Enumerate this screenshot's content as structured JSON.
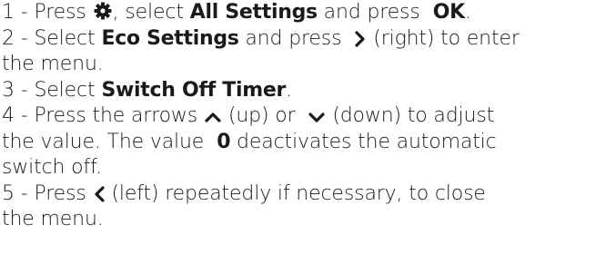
{
  "steps": {
    "s1": {
      "num": "1 -",
      "t1": "Press",
      "icon": "gear-icon",
      "t2": ", select",
      "b1": "All Settings",
      "t3": "and press",
      "b2": "OK",
      "t4": "."
    },
    "s2": {
      "num": "2 -",
      "t1": "Select",
      "b1": "Eco Settings",
      "t2": "and press",
      "icon": "chevron-right-icon",
      "t3": "(right) to enter",
      "t4": "the menu."
    },
    "s3": {
      "num": "3 -",
      "t1": "Select",
      "b1": "Switch Off Timer",
      "t2": "."
    },
    "s4": {
      "num": "4 -",
      "t1": "Press the arrows",
      "icon_up": "chevron-up-icon",
      "t2": "(up) or",
      "icon_down": "chevron-down-icon",
      "t3": "(down) to adjust",
      "t4": "the value. The value",
      "b1": "0",
      "t5": "deactivates the automatic",
      "t6": "switch off."
    },
    "s5": {
      "num": "5 -",
      "t1": "Press",
      "icon": "chevron-left-icon",
      "t2": "(left) repeatedly if necessary, to close",
      "t3": "the menu."
    }
  }
}
